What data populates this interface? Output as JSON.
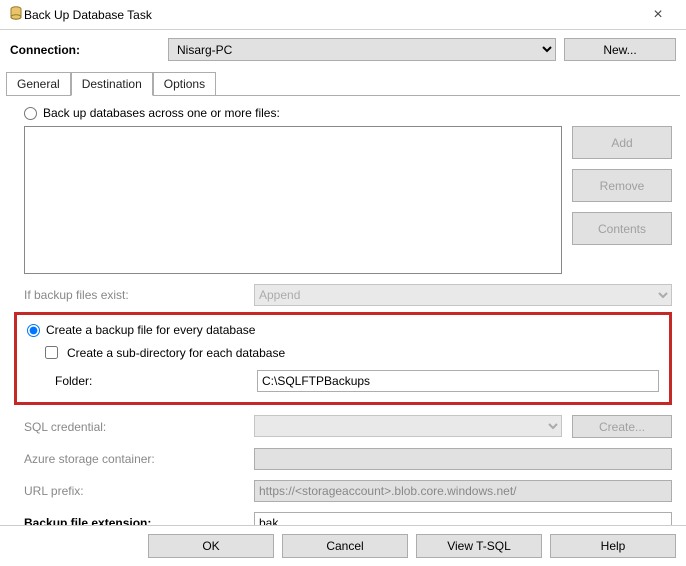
{
  "window": {
    "title": "Back Up Database Task"
  },
  "connection": {
    "label": "Connection:",
    "selected": "Nisarg-PC",
    "new_label": "New..."
  },
  "tabs": {
    "general": "General",
    "destination": "Destination",
    "options": "Options"
  },
  "dest": {
    "radio_across": "Back up databases across one or more files:",
    "add": "Add",
    "remove": "Remove",
    "contents": "Contents",
    "if_exist_label": "If backup files exist:",
    "if_exist_value": "Append",
    "radio_every": "Create a backup file for every database",
    "check_subdir": "Create a sub-directory for each database",
    "folder_label": "Folder:",
    "folder_value": "C:\\SQLFTPBackups",
    "browse": "...",
    "sql_cred_label": "SQL credential:",
    "create_label": "Create...",
    "azure_label": "Azure storage container:",
    "url_label": "URL prefix:",
    "url_value": "https://<storageaccount>.blob.core.windows.net/",
    "ext_label": "Backup file extension:",
    "ext_value": "bak"
  },
  "footer": {
    "ok": "OK",
    "cancel": "Cancel",
    "view_tsql": "View T-SQL",
    "help": "Help"
  }
}
